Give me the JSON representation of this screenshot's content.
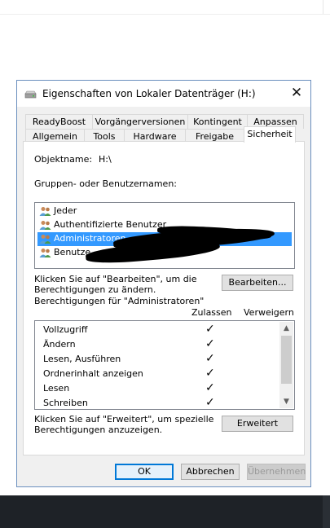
{
  "dialog": {
    "title": "Eigenschaften von Lokaler Datenträger (H:)",
    "close_symbol": "✕",
    "icons": {
      "title": "drive-icon",
      "user": "users-icon",
      "check": "✓"
    }
  },
  "tabs": {
    "row1": [
      "ReadyBoost",
      "Vorgängerversionen",
      "Kontingent",
      "Anpassen"
    ],
    "row2": [
      "Allgemein",
      "Tools",
      "Hardware",
      "Freigabe",
      "Sicherheit"
    ],
    "active": "Sicherheit"
  },
  "security": {
    "object_label": "Objektname:",
    "object_value": "H:\\",
    "groups_label": "Gruppen- oder Benutzernamen:",
    "users": [
      "Jeder",
      "Authentifizierte Benutzer",
      "Administratoren",
      "Benutze"
    ],
    "selected_user": "Administratoren",
    "edit_hint": "Klicken Sie auf \"Bearbeiten\", um die Berechtigungen zu ändern.",
    "edit_button": "Bearbeiten...",
    "permissions_for": "Berechtigungen für \"Administratoren\"",
    "col_allow": "Zulassen",
    "col_deny": "Verweigern",
    "permissions": [
      {
        "name": "Vollzugriff",
        "allow": true
      },
      {
        "name": "Ändern",
        "allow": true
      },
      {
        "name": "Lesen, Ausführen",
        "allow": true
      },
      {
        "name": "Ordnerinhalt anzeigen",
        "allow": true
      },
      {
        "name": "Lesen",
        "allow": true
      },
      {
        "name": "Schreiben",
        "allow": true
      }
    ],
    "advanced_hint": "Klicken Sie auf \"Erweitert\", um spezielle Berechtigungen anzuzeigen.",
    "advanced_button": "Erweitert"
  },
  "footer": {
    "ok": "OK",
    "cancel": "Abbrechen",
    "apply": "Übernehmen"
  }
}
